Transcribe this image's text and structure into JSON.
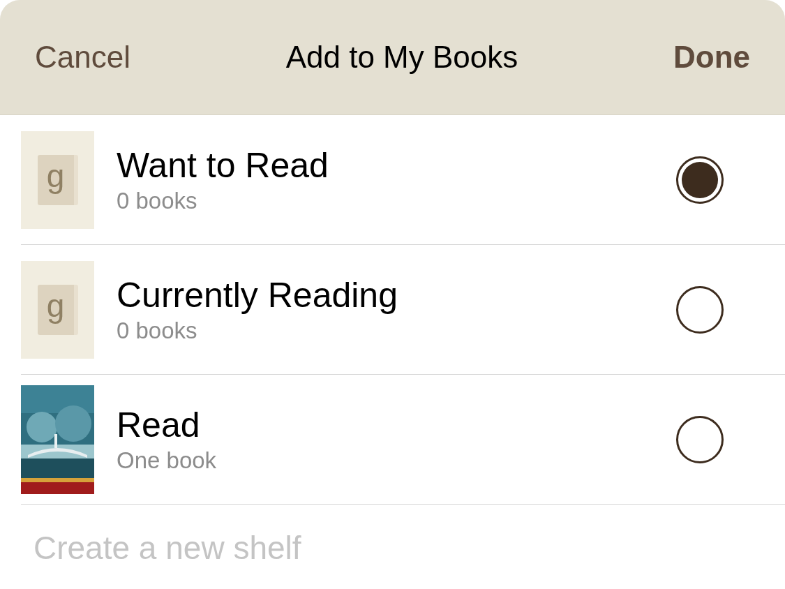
{
  "header": {
    "cancel": "Cancel",
    "title": "Add to My Books",
    "done": "Done"
  },
  "shelves": [
    {
      "kind": "generic",
      "cover_mark": "g",
      "name": "Want to Read",
      "count": "0 books",
      "selected": true
    },
    {
      "kind": "generic",
      "cover_mark": "g",
      "name": "Currently Reading",
      "count": "0 books",
      "selected": false
    },
    {
      "kind": "picture",
      "name": "Read",
      "count": "One book",
      "selected": false
    }
  ],
  "new_shelf": {
    "placeholder": "Create a new shelf"
  }
}
